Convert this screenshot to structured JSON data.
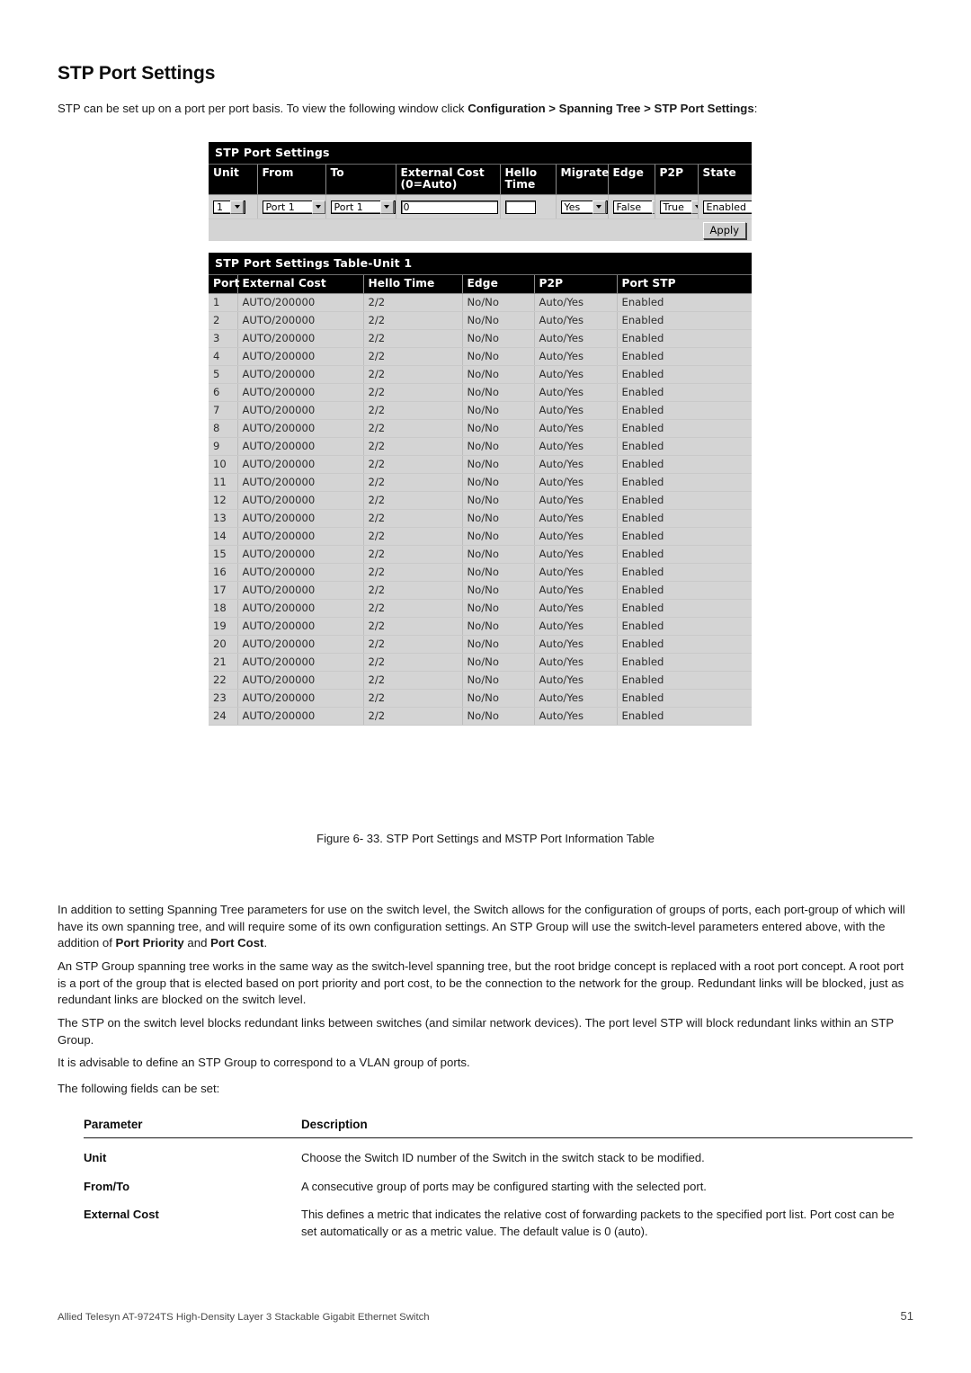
{
  "document": {
    "heading": "STP Port Settings",
    "intro_prefix": "STP can be set up on a port per port basis. To view the following window click ",
    "intro_bold": "Configuration > Spanning Tree > STP Port Settings",
    "intro_suffix": ":",
    "figure_caption": "Figure 6- 33. STP Port Settings and MSTP Port Information Table",
    "footer_left": "Allied Telesyn AT-9724TS High-Density Layer 3 Stackable Gigabit Ethernet Switch",
    "footer_page": "51"
  },
  "paragraphs": {
    "p1_a": "In addition to setting Spanning Tree parameters for use on the switch level, the Switch allows for the configuration of groups of ports, each port-group of which will have its own spanning tree, and will require some of its own configuration settings. An STP Group will use the switch-level parameters entered above, with the addition of ",
    "p1_b1": "Port Priority",
    "p1_mid": " and ",
    "p1_b2": "Port Cost",
    "p1_end": ".",
    "p2": "An STP Group spanning tree works in the same way as the switch-level spanning tree, but the root bridge concept is replaced with a root port concept. A root port is a port of the group that is elected based on port priority and port cost, to be the connection to the network for the group. Redundant links will be blocked, just as redundant links are blocked on the switch level.",
    "p3": "The STP on the switch level blocks redundant links between switches (and similar network devices). The port level STP will block redundant links within an STP Group.",
    "p4": "It is advisable to define an STP Group to correspond to a VLAN group of ports.",
    "p5": "The following fields can be set:"
  },
  "screenshot": {
    "config_panel": {
      "title": "STP Port Settings",
      "columns": [
        "Unit",
        "From",
        "To",
        "External Cost (0=Auto)",
        "Hello Time",
        "Migrate",
        "Edge",
        "P2P",
        "State"
      ],
      "column_labels": {
        "unit": "Unit",
        "from": "From",
        "to": "To",
        "external_cost_line1": "External Cost",
        "external_cost_line2": "(0=Auto)",
        "hello_line1": "Hello",
        "hello_line2": "Time",
        "migrate": "Migrate",
        "edge": "Edge",
        "p2p": "P2P",
        "state": "State"
      },
      "values": {
        "unit": "1",
        "from": "Port 1",
        "to": "Port 1",
        "external_cost": "0",
        "hello_time": "",
        "migrate": "Yes",
        "edge": "False",
        "p2p": "True",
        "state": "Enabled"
      },
      "apply_label": "Apply"
    },
    "table_panel": {
      "title": "STP Port Settings Table-Unit 1",
      "columns": [
        "Port",
        "External Cost",
        "Hello Time",
        "Edge",
        "P2P",
        "Port STP"
      ],
      "rows": [
        [
          "1",
          "AUTO/200000",
          "2/2",
          "No/No",
          "Auto/Yes",
          "Enabled"
        ],
        [
          "2",
          "AUTO/200000",
          "2/2",
          "No/No",
          "Auto/Yes",
          "Enabled"
        ],
        [
          "3",
          "AUTO/200000",
          "2/2",
          "No/No",
          "Auto/Yes",
          "Enabled"
        ],
        [
          "4",
          "AUTO/200000",
          "2/2",
          "No/No",
          "Auto/Yes",
          "Enabled"
        ],
        [
          "5",
          "AUTO/200000",
          "2/2",
          "No/No",
          "Auto/Yes",
          "Enabled"
        ],
        [
          "6",
          "AUTO/200000",
          "2/2",
          "No/No",
          "Auto/Yes",
          "Enabled"
        ],
        [
          "7",
          "AUTO/200000",
          "2/2",
          "No/No",
          "Auto/Yes",
          "Enabled"
        ],
        [
          "8",
          "AUTO/200000",
          "2/2",
          "No/No",
          "Auto/Yes",
          "Enabled"
        ],
        [
          "9",
          "AUTO/200000",
          "2/2",
          "No/No",
          "Auto/Yes",
          "Enabled"
        ],
        [
          "10",
          "AUTO/200000",
          "2/2",
          "No/No",
          "Auto/Yes",
          "Enabled"
        ],
        [
          "11",
          "AUTO/200000",
          "2/2",
          "No/No",
          "Auto/Yes",
          "Enabled"
        ],
        [
          "12",
          "AUTO/200000",
          "2/2",
          "No/No",
          "Auto/Yes",
          "Enabled"
        ],
        [
          "13",
          "AUTO/200000",
          "2/2",
          "No/No",
          "Auto/Yes",
          "Enabled"
        ],
        [
          "14",
          "AUTO/200000",
          "2/2",
          "No/No",
          "Auto/Yes",
          "Enabled"
        ],
        [
          "15",
          "AUTO/200000",
          "2/2",
          "No/No",
          "Auto/Yes",
          "Enabled"
        ],
        [
          "16",
          "AUTO/200000",
          "2/2",
          "No/No",
          "Auto/Yes",
          "Enabled"
        ],
        [
          "17",
          "AUTO/200000",
          "2/2",
          "No/No",
          "Auto/Yes",
          "Enabled"
        ],
        [
          "18",
          "AUTO/200000",
          "2/2",
          "No/No",
          "Auto/Yes",
          "Enabled"
        ],
        [
          "19",
          "AUTO/200000",
          "2/2",
          "No/No",
          "Auto/Yes",
          "Enabled"
        ],
        [
          "20",
          "AUTO/200000",
          "2/2",
          "No/No",
          "Auto/Yes",
          "Enabled"
        ],
        [
          "21",
          "AUTO/200000",
          "2/2",
          "No/No",
          "Auto/Yes",
          "Enabled"
        ],
        [
          "22",
          "AUTO/200000",
          "2/2",
          "No/No",
          "Auto/Yes",
          "Enabled"
        ],
        [
          "23",
          "AUTO/200000",
          "2/2",
          "No/No",
          "Auto/Yes",
          "Enabled"
        ],
        [
          "24",
          "AUTO/200000",
          "2/2",
          "No/No",
          "Auto/Yes",
          "Enabled"
        ]
      ]
    }
  },
  "parameter_table": {
    "header": [
      "Parameter",
      "Description"
    ],
    "rows": [
      {
        "name": "Unit",
        "description": "Choose the Switch ID number of the Switch in the switch stack to be modified."
      },
      {
        "name": "From/To",
        "description": "A consecutive group of ports may be configured starting with the selected port."
      },
      {
        "name": "External Cost",
        "description": "This defines a metric that indicates the relative cost of forwarding packets to the specified port list. Port cost can be set automatically or as a metric value. The default value is 0 (auto)."
      }
    ]
  }
}
